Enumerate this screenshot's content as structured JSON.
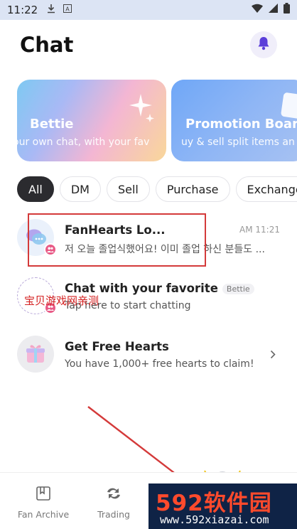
{
  "status_bar": {
    "time": "11:22",
    "left_icons": [
      "download-icon",
      "font-icon"
    ],
    "right_icons": [
      "wifi-icon",
      "cell-signal-icon",
      "battery-icon"
    ]
  },
  "header": {
    "title": "Chat",
    "bell_icon": "bell-icon",
    "accent_color": "#5b3fd9"
  },
  "banners": [
    {
      "title": "Bettie",
      "subtitle": "our own chat, with your fav"
    },
    {
      "title": "Promotion Board",
      "subtitle": "uy & sell split items an"
    }
  ],
  "filters": {
    "items": [
      "All",
      "DM",
      "Sell",
      "Purchase",
      "Exchange"
    ],
    "selected": "All"
  },
  "chats": [
    {
      "title": "FanHearts Lo...",
      "preview": "저 오늘 졸업식했어요! 이미 졸업 하신 분들도 ...",
      "time": "AM 11:21",
      "avatar_icon": "chat-bubbles-icon",
      "badge_icon": "group-icon"
    },
    {
      "title": "Chat with your favorite",
      "tag": "Bettie",
      "preview": "Tap here to start chatting",
      "avatar_icon": "empty-avatar-icon",
      "badge_icon": "group-icon"
    },
    {
      "title": "Get Free Hearts",
      "preview": "You have 1,000+ free hearts to claim!",
      "avatar_icon": "gift-icon",
      "action_icon": "chevron-right-icon"
    }
  ],
  "overlay_text": "宝贝游戏网亲测",
  "bottom_nav": {
    "items": [
      {
        "label": "Fan Archive",
        "icon": "archive-icon"
      },
      {
        "label": "Trading",
        "icon": "trading-icon"
      }
    ]
  },
  "watermark": {
    "brand": "592软件园",
    "url": "www.592xiazai.com"
  },
  "colors": {
    "badge": "#e85a86",
    "active_chip": "#2b2b2f",
    "annotation_red": "#d43a3a"
  }
}
